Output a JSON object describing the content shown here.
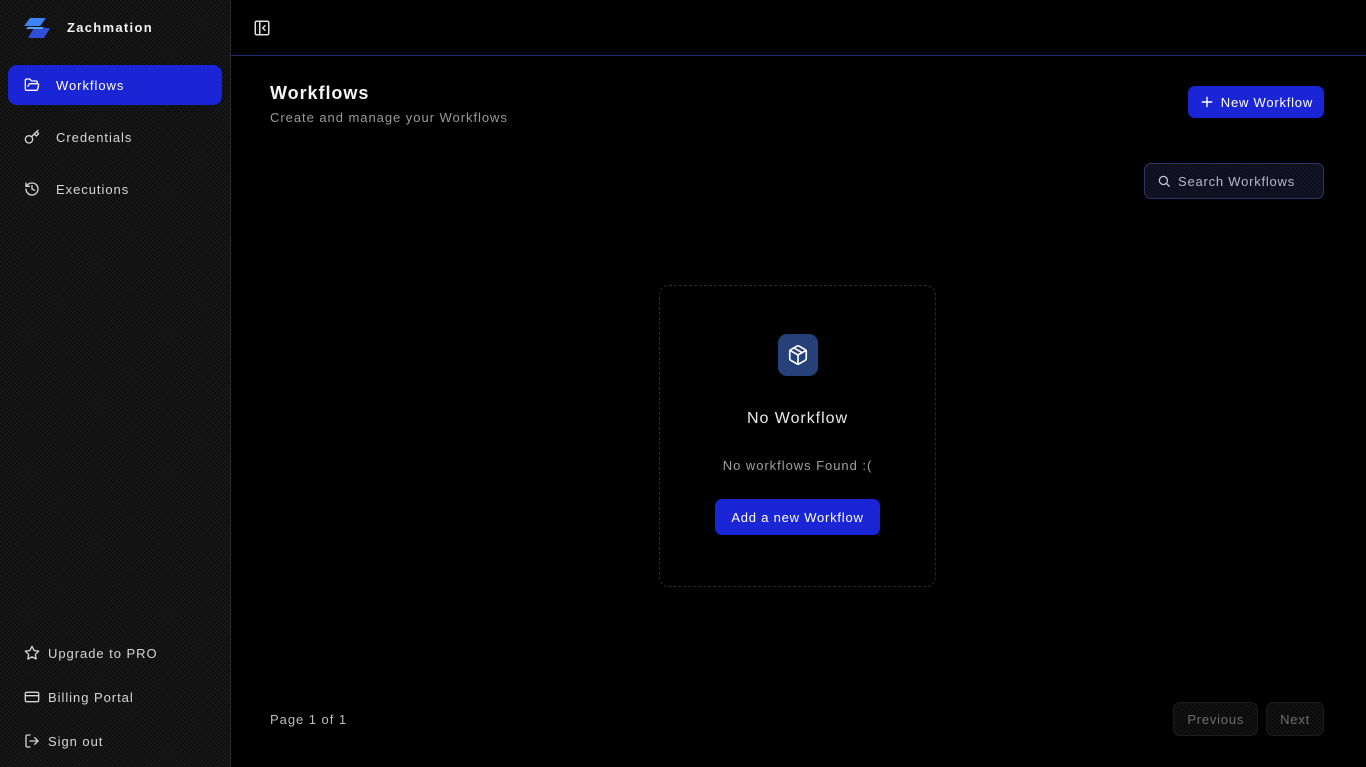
{
  "app": {
    "name": "Zachmation"
  },
  "sidebar": {
    "items": [
      {
        "label": "Workflows",
        "icon": "folder-open-icon",
        "active": true
      },
      {
        "label": "Credentials",
        "icon": "key-icon",
        "active": false
      },
      {
        "label": "Executions",
        "icon": "history-icon",
        "active": false
      }
    ],
    "bottom": [
      {
        "label": "Upgrade to PRO",
        "icon": "star-icon"
      },
      {
        "label": "Billing Portal",
        "icon": "credit-card-icon"
      },
      {
        "label": "Sign out",
        "icon": "log-out-icon"
      }
    ]
  },
  "header": {
    "title": "Workflows",
    "subtitle": "Create and manage your Workflows",
    "new_button": "New Workflow"
  },
  "search": {
    "placeholder": "Search Workflows"
  },
  "empty_state": {
    "icon": "package-icon",
    "title": "No Workflow",
    "message": "No workflows Found :(",
    "button": "Add a new Workflow"
  },
  "pagination": {
    "info": "Page 1 of 1",
    "previous": "Previous",
    "next": "Next"
  },
  "colors": {
    "accent": "#1a25d6",
    "background": "#000000",
    "sidebar": "#0e0e0e"
  }
}
